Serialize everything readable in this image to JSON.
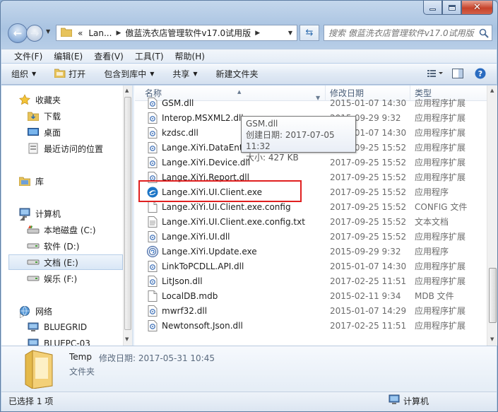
{
  "addressbar": {
    "crumb_prefix": "«",
    "crumbs": [
      "Lan...",
      "傲蓝洗衣店管理软件v17.0试用版"
    ]
  },
  "search": {
    "placeholder": "搜索 傲蓝洗衣店管理软件v17.0试用版"
  },
  "menu": [
    "文件(F)",
    "编辑(E)",
    "查看(V)",
    "工具(T)",
    "帮助(H)"
  ],
  "toolbar": {
    "organize": "组织",
    "open": "打开",
    "include_library": "包含到库中",
    "share": "共享",
    "new_folder": "新建文件夹"
  },
  "nav": {
    "favorites": "收藏夹",
    "downloads": "下载",
    "desktop": "桌面",
    "recent": "最近访问的位置",
    "libraries": "库",
    "computer": "计算机",
    "drive_c": "本地磁盘 (C:)",
    "drive_d": "软件 (D:)",
    "drive_e": "文档 (E:)",
    "drive_f": "娱乐 (F:)",
    "network": "网络",
    "net1": "BLUEGRID",
    "net2": "BLUEPC-03"
  },
  "columns": {
    "name": "名称",
    "date": "修改日期",
    "type": "类型"
  },
  "files": [
    {
      "name": "GSM.dll",
      "date": "2015-01-07 14:30",
      "type": "应用程序扩展",
      "icon": "dll-icon"
    },
    {
      "name": "Interop.MSXML2.dll",
      "date": "2015-09-29 9:32",
      "type": "应用程序扩展",
      "icon": "dll-icon"
    },
    {
      "name": "kzdsc.dll",
      "date": "2015-01-07 14:30",
      "type": "应用程序扩展",
      "icon": "dll-icon"
    },
    {
      "name": "Lange.XiYi.DataEntity.dll",
      "date": "2017-09-25 15:52",
      "type": "应用程序扩展",
      "icon": "dll-icon"
    },
    {
      "name": "Lange.XiYi.Device.dll",
      "date": "2017-09-25 15:52",
      "type": "应用程序扩展",
      "icon": "dll-icon"
    },
    {
      "name": "Lange.XiYi.Report.dll",
      "date": "2017-09-25 15:52",
      "type": "应用程序扩展",
      "icon": "dll-icon"
    },
    {
      "name": "Lange.XiYi.UI.Client.exe",
      "date": "2017-09-25 15:52",
      "type": "应用程序",
      "icon": "app-icon"
    },
    {
      "name": "Lange.XiYi.UI.Client.exe.config",
      "date": "2017-09-25 15:52",
      "type": "CONFIG 文件",
      "icon": "file-icon"
    },
    {
      "name": "Lange.XiYi.UI.Client.exe.config.txt",
      "date": "2017-09-25 15:52",
      "type": "文本文档",
      "icon": "txt-icon"
    },
    {
      "name": "Lange.XiYi.UI.dll",
      "date": "2017-09-25 15:52",
      "type": "应用程序扩展",
      "icon": "dll-icon"
    },
    {
      "name": "Lange.XiYi.Update.exe",
      "date": "2015-09-29 9:32",
      "type": "应用程序",
      "icon": "update-icon"
    },
    {
      "name": "LinkToPCDLL.API.dll",
      "date": "2015-01-07 14:30",
      "type": "应用程序扩展",
      "icon": "dll-icon"
    },
    {
      "name": "LitJson.dll",
      "date": "2017-02-25 11:51",
      "type": "应用程序扩展",
      "icon": "dll-icon"
    },
    {
      "name": "LocalDB.mdb",
      "date": "2015-02-11 9:34",
      "type": "MDB 文件",
      "icon": "file-icon"
    },
    {
      "name": "mwrf32.dll",
      "date": "2015-01-07 14:29",
      "type": "应用程序扩展",
      "icon": "dll-icon"
    },
    {
      "name": "Newtonsoft.Json.dll",
      "date": "2017-02-25 11:51",
      "type": "应用程序扩展",
      "icon": "dll-icon"
    }
  ],
  "tooltip": {
    "name": "GSM.dll",
    "created": "创建日期: 2017-07-05 11:32",
    "size": "大小: 427 KB"
  },
  "details": {
    "name": "Temp",
    "modified": "修改日期: 2017-05-31 10:45",
    "type": "文件夹"
  },
  "status": {
    "selection": "已选择 1 项",
    "location": "计算机"
  }
}
